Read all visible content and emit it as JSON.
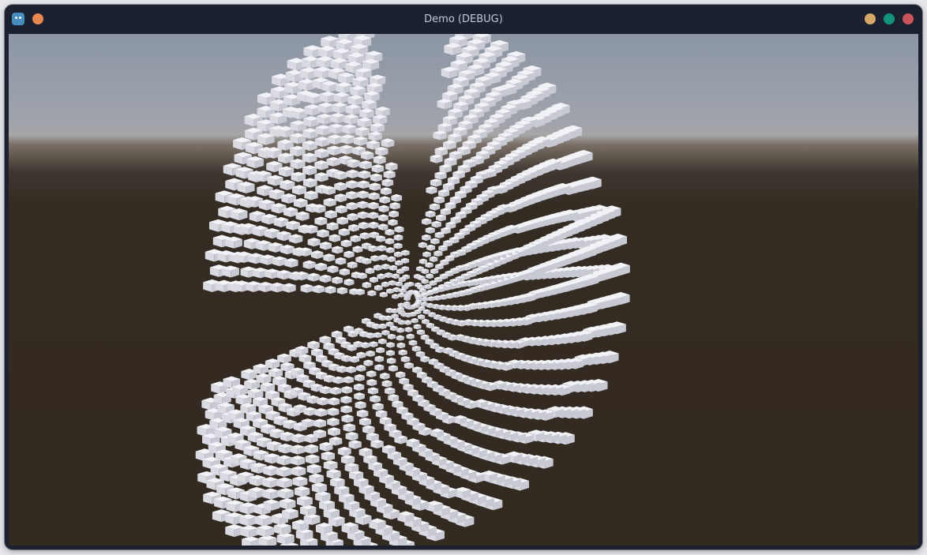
{
  "window": {
    "title": "Demo (DEBUG)",
    "app_icon": "godot-icon",
    "buttons": {
      "left": {
        "icon": "circle-orange",
        "color": "#e8874f"
      },
      "minimize": {
        "icon": "circle-yellow",
        "color": "#d5a86a"
      },
      "maximize": {
        "icon": "circle-green",
        "color": "#12917d"
      },
      "close": {
        "icon": "circle-red",
        "color": "#c9545a"
      }
    }
  },
  "scene": {
    "sky_color": "#8c96a4",
    "horizon_color": "#a6a6a6",
    "ground_color": "#332a21",
    "cube_color": "#e9eaef"
  }
}
